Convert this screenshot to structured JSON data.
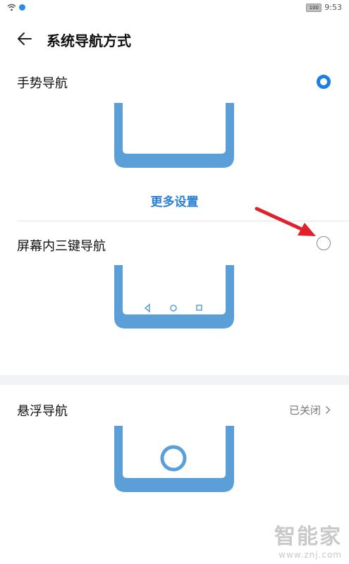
{
  "status_bar": {
    "time": "9:53",
    "battery": "100",
    "wifi_icon": "wifi-icon",
    "notification_icon": "notification-dot-icon"
  },
  "header": {
    "title": "系统导航方式",
    "back_icon": "back-arrow-icon"
  },
  "options": [
    {
      "label": "手势导航",
      "selected": true
    },
    {
      "label": "屏幕内三键导航",
      "selected": false
    }
  ],
  "gesture": {
    "more_settings": "更多设置"
  },
  "floating": {
    "label": "悬浮导航",
    "status": "已关闭"
  },
  "watermark": {
    "logo": "智能家",
    "url": "www.znj.com"
  },
  "colors": {
    "accent": "#1d7fe0",
    "phone_blue": "#5b9fd8",
    "arrow_red": "#e0202a"
  }
}
